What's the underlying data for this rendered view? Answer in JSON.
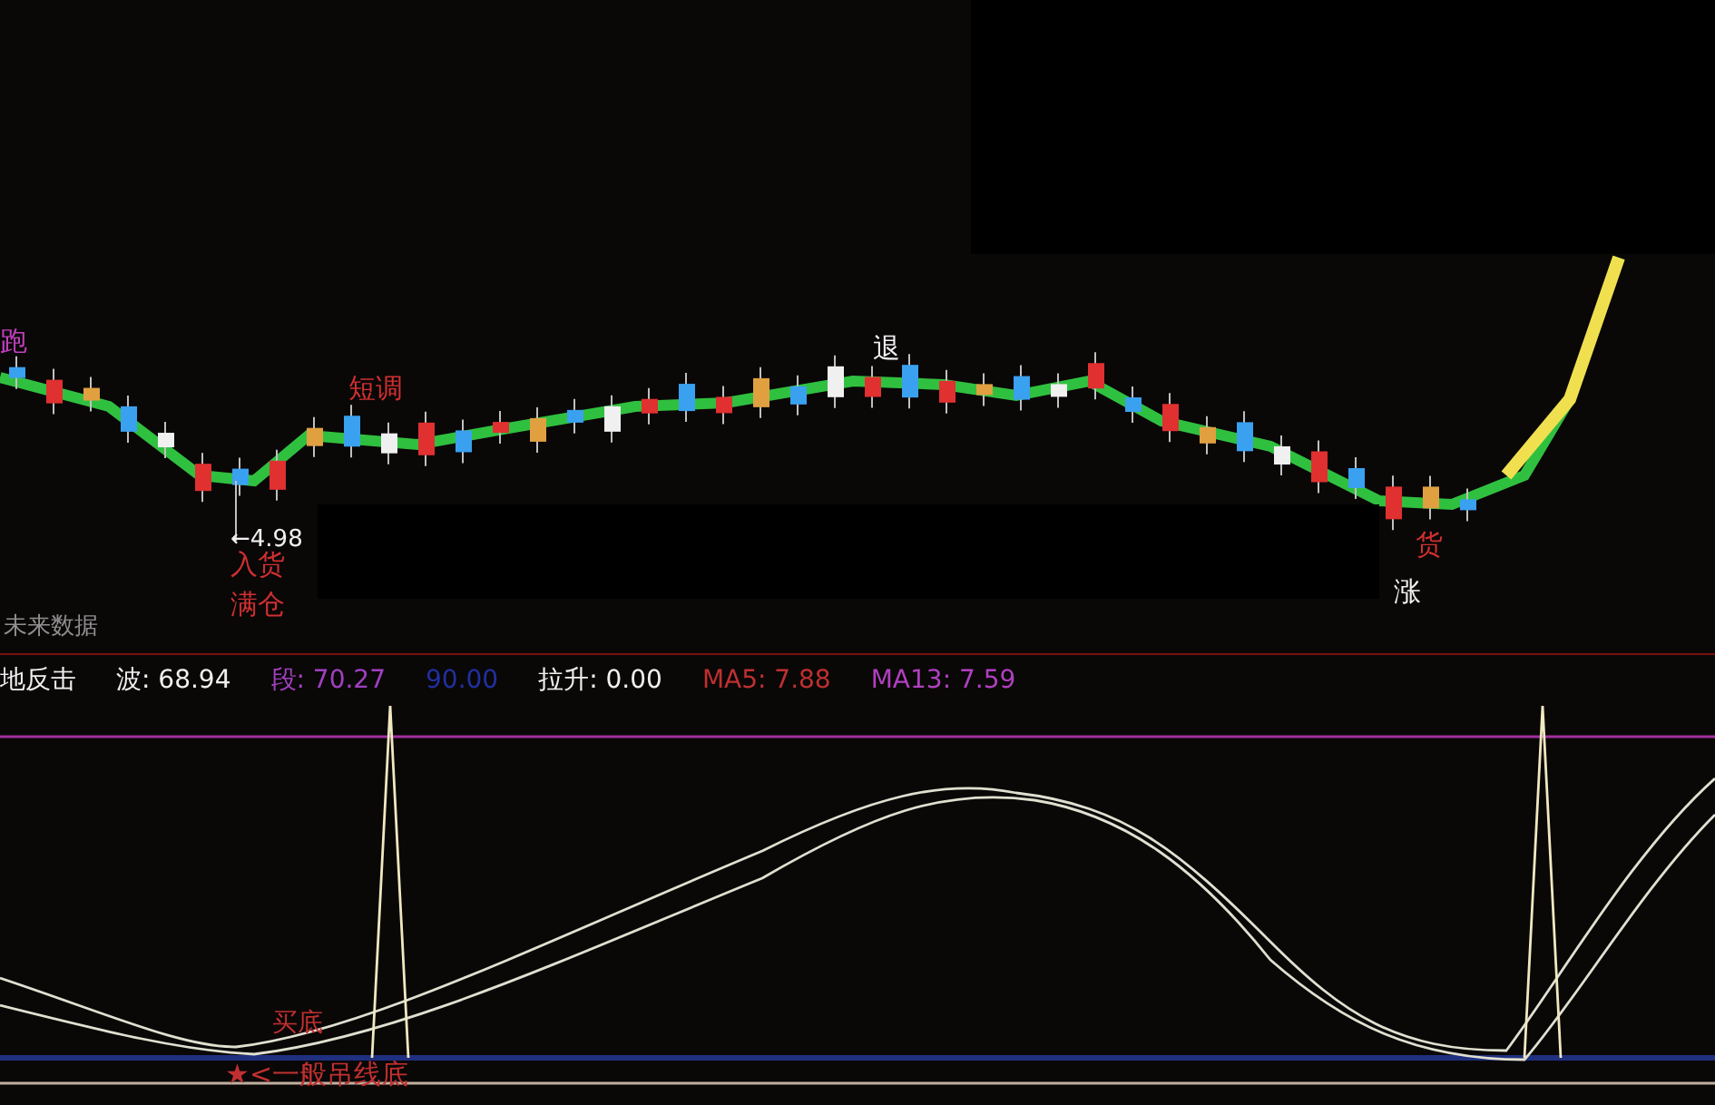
{
  "price_pane": {
    "labels": [
      {
        "kind": "signal",
        "text": "跑",
        "color": "#c040c0"
      },
      {
        "kind": "signal",
        "text": "退",
        "color": "#f0f0f0"
      },
      {
        "kind": "signal",
        "text": "短调",
        "color": "#d03030"
      },
      {
        "kind": "price",
        "text": "←4.98",
        "color": "#f0f0f0"
      },
      {
        "kind": "signal",
        "text": "入货",
        "color": "#d03030"
      },
      {
        "kind": "signal",
        "text": "满仓",
        "color": "#d03030"
      },
      {
        "kind": "note",
        "text": "未来数据",
        "color": "#909090"
      },
      {
        "kind": "signal",
        "text": "货",
        "color": "#d03030"
      },
      {
        "kind": "signal",
        "text": "涨",
        "color": "#f0f0f0"
      }
    ]
  },
  "indicator_header": {
    "items": [
      {
        "text": "地反击",
        "color": "#f0f0f0"
      },
      {
        "text": "波: 68.94",
        "color": "#f0f0f0"
      },
      {
        "text": "段: 70.27",
        "color": "#a040c0"
      },
      {
        "text": "90.00",
        "color": "#2030a0"
      },
      {
        "text": "拉升: 0.00",
        "color": "#f0f0f0"
      },
      {
        "text": "MA5: 7.88",
        "color": "#c03030"
      },
      {
        "text": "MA13: 7.59",
        "color": "#b040c0"
      }
    ]
  },
  "indicator_pane": {
    "labels": [
      {
        "text": "买底",
        "color": "#c03030"
      },
      {
        "text": "★<一般吊线底",
        "color": "#c03030"
      }
    ]
  }
}
